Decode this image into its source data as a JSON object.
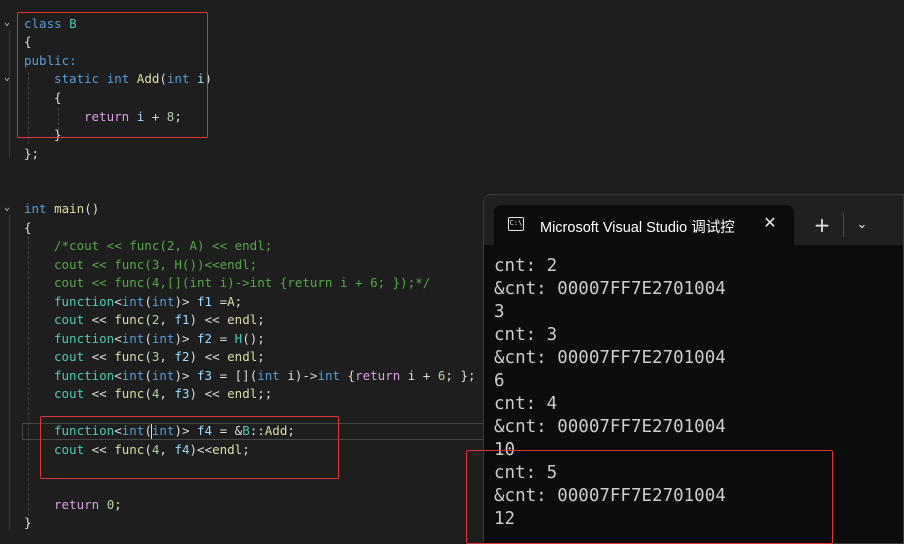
{
  "editor": {
    "class_block": {
      "l1": {
        "kw": "class",
        "name": "B"
      },
      "l2": "{",
      "l3": "public:",
      "l4": {
        "kw1": "static",
        "kw2": "int",
        "fn": "Add",
        "open": "(",
        "kw3": "int",
        "param": "i",
        "close": ")"
      },
      "l5": "{",
      "l6": {
        "kw": "return",
        "param": "i",
        "rest": " + ",
        "num": "8",
        "end": ";"
      },
      "l7": "}",
      "l8": "};"
    },
    "main_block": {
      "sig": {
        "kw": "int",
        "fn": "main",
        "rest": "()"
      },
      "open": "{",
      "c1": "/*cout << func(2, A) << endl;",
      "c2": "cout << func(3, H())<<endl;",
      "c3": "cout << func(4,[](int i)->int {return i + 6; });*/",
      "s1": {
        "a": "function",
        "b": "<",
        "c": "int",
        "d": "(",
        "e": "int",
        "f": ")> ",
        "g": "f1",
        "h": " =",
        "i": "A",
        "j": ";"
      },
      "s2": {
        "a": "cout",
        "b": " << ",
        "c": "func",
        "d": "(",
        "e": "2",
        "f": ", ",
        "g": "f1",
        "h": ") << ",
        "i": "endl",
        "j": ";"
      },
      "s3": {
        "a": "function",
        "b": "<",
        "c": "int",
        "d": "(",
        "e": "int",
        "f": ")> ",
        "g": "f2",
        "h": " = ",
        "i": "H",
        "j": "();"
      },
      "s4": {
        "a": "cout",
        "b": " << ",
        "c": "func",
        "d": "(",
        "e": "3",
        "f": ", ",
        "g": "f2",
        "h": ") << ",
        "i": "endl",
        "j": ";"
      },
      "s5": {
        "a": "function",
        "b": "<",
        "c": "int",
        "d": "(",
        "e": "int",
        "f": ")> ",
        "g": "f3",
        "h": " = [](",
        "i": "int",
        "j": " i)->",
        "k": "int",
        "l": " {",
        "m": "return",
        "n": " i + ",
        "o": "6",
        "p": "; };"
      },
      "s6": {
        "a": "cout",
        "b": " << ",
        "c": "func",
        "d": "(",
        "e": "4",
        "f": ", ",
        "g": "f3",
        "h": ") << ",
        "i": "endl",
        "j": ";;"
      },
      "s7": {
        "a": "function",
        "b": "<",
        "c": "int",
        "d": "(",
        "e": "int",
        "f": ")> ",
        "g": "f4",
        "h": " = &",
        "i": "B",
        "j": "::",
        "k": "Add",
        "l": ";"
      },
      "s8": {
        "a": "cout",
        "b": " << ",
        "c": "func",
        "d": "(",
        "e": "4",
        "f": ", ",
        "g": "f4",
        "h": ")<<",
        "i": "endl",
        "j": ";"
      },
      "ret": {
        "kw": "return",
        "num": "0",
        "end": ";"
      },
      "close": "}"
    },
    "fold_glyph": "⌄"
  },
  "console": {
    "tab_icon_text": "C:\\",
    "tab_title": "Microsoft Visual Studio 调试控",
    "close_glyph": "✕",
    "new_tab_glyph": "+",
    "dropdown_glyph": "⌄",
    "output": "cnt: 2\n&cnt: 00007FF7E2701004\n3\ncnt: 3\n&cnt: 00007FF7E2701004\n6\ncnt: 4\n&cnt: 00007FF7E2701004\n10\ncnt: 5\n&cnt: 00007FF7E2701004\n12"
  },
  "colors": {
    "keyword": "#569cd6",
    "type": "#4ec9b0",
    "function": "#dcdcaa",
    "comment": "#57a64a",
    "number": "#b5cea8",
    "highlight_box": "#e0323a"
  }
}
